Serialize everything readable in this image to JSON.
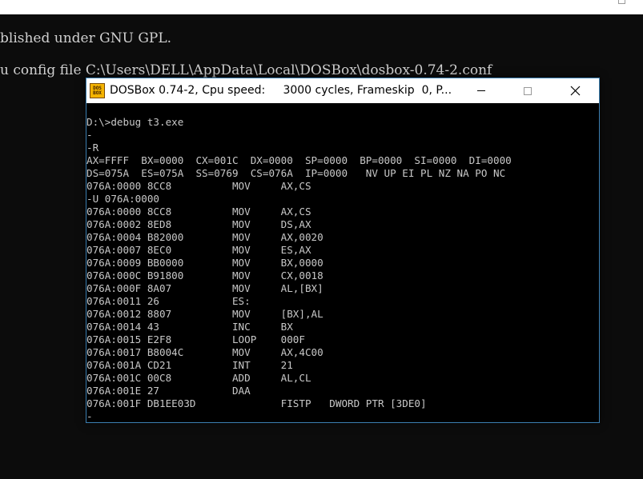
{
  "background_console": {
    "line_1": "blished under GNU GPL.",
    "line_2": "u config file C:\\Users\\DELL\\AppData\\Local\\DOSBox\\dosbox-0.74-2.conf"
  },
  "window": {
    "title": "DOSBox 0.74-2, Cpu speed:     3000 cycles, Frameskip  0, P...",
    "icon_name": "dosbox-icon",
    "icon_text_top": "DOS",
    "icon_text_bottom": "BOX"
  },
  "terminal": {
    "lines": [
      "D:\\>debug t3.exe",
      "-",
      "-R",
      "AX=FFFF  BX=0000  CX=001C  DX=0000  SP=0000  BP=0000  SI=0000  DI=0000",
      "DS=075A  ES=075A  SS=0769  CS=076A  IP=0000   NV UP EI PL NZ NA PO NC",
      "076A:0000 8CC8          MOV     AX,CS",
      "-U 076A:0000",
      "076A:0000 8CC8          MOV     AX,CS",
      "076A:0002 8ED8          MOV     DS,AX",
      "076A:0004 B82000        MOV     AX,0020",
      "076A:0007 8EC0          MOV     ES,AX",
      "076A:0009 BB0000        MOV     BX,0000",
      "076A:000C B91800        MOV     CX,0018",
      "076A:000F 8A07          MOV     AL,[BX]",
      "076A:0011 26            ES:",
      "076A:0012 8807          MOV     [BX],AL",
      "076A:0014 43            INC     BX",
      "076A:0015 E2F8          LOOP    000F",
      "076A:0017 B8004C        MOV     AX,4C00",
      "076A:001A CD21          INT     21",
      "076A:001C 00C8          ADD     AL,CL",
      "076A:001E 27            DAA",
      "076A:001F DB1EE03D              FISTP   DWORD PTR [3DE0]",
      "-"
    ]
  },
  "colors": {
    "desktop_background": "#0c0c0c",
    "terminal_text": "#c8c8c8",
    "window_border": "#3c7fb1",
    "titlebar": "#ffffff"
  }
}
